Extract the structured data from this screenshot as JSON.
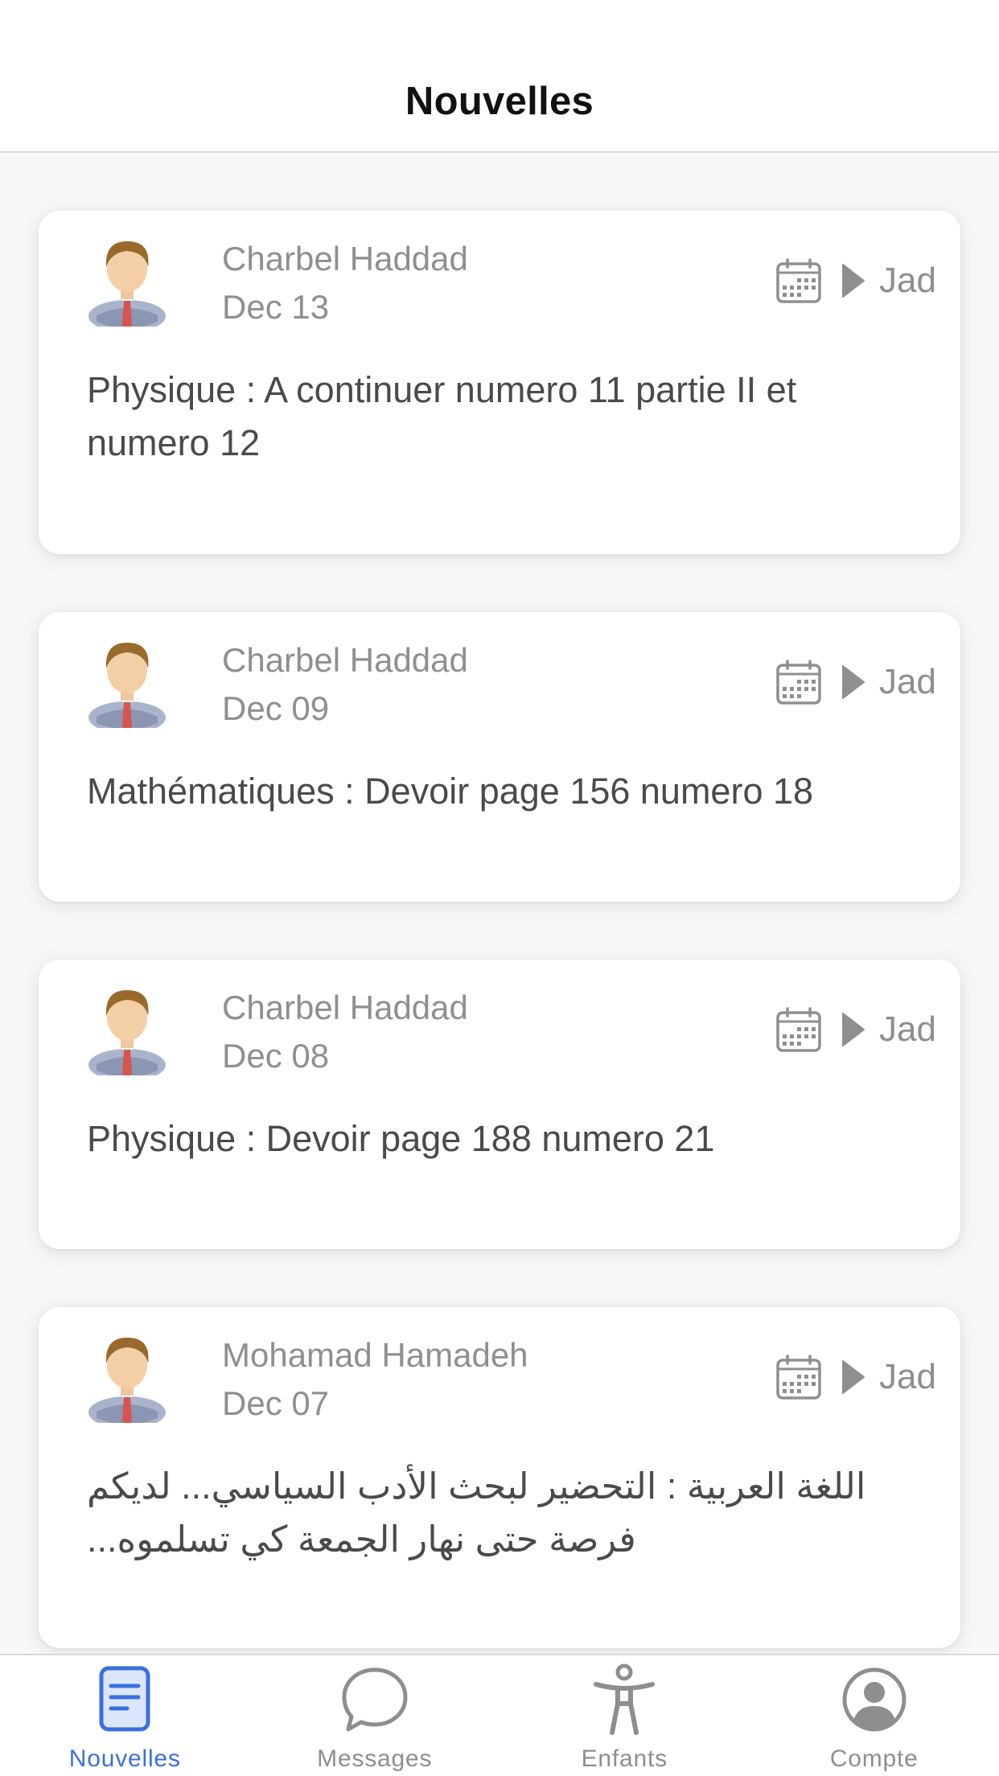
{
  "header": {
    "title": "Nouvelles"
  },
  "colors": {
    "accent": "#3b6fe0",
    "muted": "#8f8f8f",
    "body_text": "#4a4a4a"
  },
  "feed": [
    {
      "author": "Charbel Haddad",
      "date": "Dec 13",
      "child": "Jad",
      "text": "Physique : A continuer numero 11 partie II et numero 12",
      "rtl": false
    },
    {
      "author": "Charbel Haddad",
      "date": "Dec 09",
      "child": "Jad",
      "text": "Mathématiques : Devoir page 156 numero 18",
      "rtl": false
    },
    {
      "author": "Charbel Haddad",
      "date": "Dec 08",
      "child": "Jad",
      "text": "Physique : Devoir page 188 numero 21",
      "rtl": false
    },
    {
      "author": "Mohamad Hamadeh",
      "date": "Dec 07",
      "child": "Jad",
      "text": "اللغة العربية : التحضير لبحث الأدب السياسي... لديكم فرصة حتى نهار الجمعة كي تسلموه...",
      "rtl": true
    }
  ],
  "tabs": [
    {
      "label": "Nouvelles",
      "icon": "news-icon",
      "active": true
    },
    {
      "label": "Messages",
      "icon": "message-bubble-icon",
      "active": false
    },
    {
      "label": "Enfants",
      "icon": "person-icon",
      "active": false
    },
    {
      "label": "Compte",
      "icon": "account-circle-icon",
      "active": false
    }
  ]
}
